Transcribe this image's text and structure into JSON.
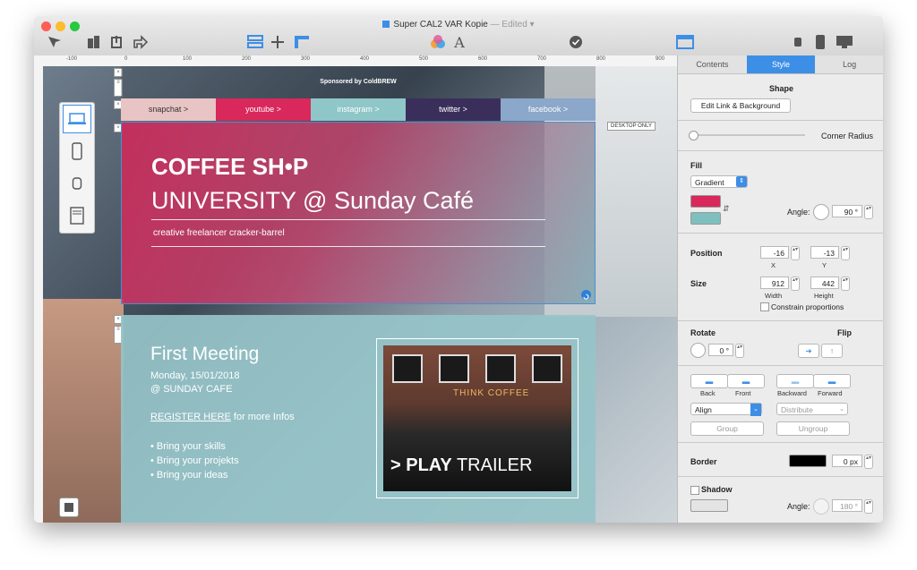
{
  "window": {
    "title": "Super CAL2 VAR Kopie",
    "edited_label": "— Edited ▾"
  },
  "ruler": {
    "ticks": [
      "-100",
      "0",
      "100",
      "200",
      "300",
      "400",
      "500",
      "600",
      "700",
      "800",
      "900"
    ]
  },
  "canvas": {
    "sponsor_text": "Sponsored by ColdBREW",
    "nav_items": [
      {
        "label": "snapchat >",
        "color": "#e8c4c4",
        "text_color": "#333333"
      },
      {
        "label": "youtube >",
        "color": "#d9285b",
        "text_color": "#ffffff"
      },
      {
        "label": "instagram >",
        "color": "#8fc6c8",
        "text_color": "#ffffff"
      },
      {
        "label": "twitter >",
        "color": "#3a2f5b",
        "text_color": "#ffffff"
      },
      {
        "label": "facebook >",
        "color": "#8ba7c9",
        "text_color": "#ffffff"
      }
    ],
    "desktop_only_badge": "DESKTOP ONLY",
    "hero": {
      "title": "COFFEE SH•P",
      "subtitle": "UNIVERSITY @ Sunday Café",
      "tagline": "creative freelancer cracker-barrel"
    },
    "meeting": {
      "title": "First Meeting",
      "date": "Monday, 15/01/2018",
      "location": "@ SUNDAY CAFE",
      "register_link": "REGISTER HERE",
      "register_suffix": " for more Infos",
      "bullets": [
        "• Bring your skills",
        "• Bring your projekts",
        "• Bring your ideas"
      ],
      "play_bold": "> PLAY",
      "play_rest": " TRAILER",
      "sign_text": "THINK COFFEE"
    }
  },
  "panel": {
    "tabs": [
      "Contents",
      "Style",
      "Log"
    ],
    "active_tab": "Style",
    "shape_heading": "Shape",
    "edit_link_button": "Edit Link & Background",
    "corner_radius_label": "Corner Radius",
    "fill_label": "Fill",
    "fill_type": "Gradient",
    "gradient_color_1": "#d9285b",
    "gradient_color_2": "#7fbfbe",
    "angle_label": "Angle:",
    "fill_angle": "90 °",
    "position_label": "Position",
    "pos_x": "-16",
    "pos_y": "-13",
    "x_label": "X",
    "y_label": "Y",
    "size_label": "Size",
    "width": "912",
    "height": "442",
    "width_label": "Width",
    "height_label": "Height",
    "constrain_label": "Constrain proportions",
    "rotate_label": "Rotate",
    "rotate_value": "0 °",
    "flip_label": "Flip",
    "back_label": "Back",
    "front_label": "Front",
    "backward_label": "Backward",
    "forward_label": "Forward",
    "align_label": "Align",
    "distribute_label": "Distribute",
    "group_label": "Group",
    "ungroup_label": "Ungroup",
    "border_label": "Border",
    "border_value": "0 px",
    "shadow_label": "Shadow",
    "shadow_angle_label": "Angle:",
    "shadow_angle": "180 °"
  },
  "colors": {
    "accent": "#3d8ee6",
    "hero_pink": "#cc2a5a",
    "hero_teal": "#80a8b2",
    "meeting_teal": "#96c4c9"
  }
}
